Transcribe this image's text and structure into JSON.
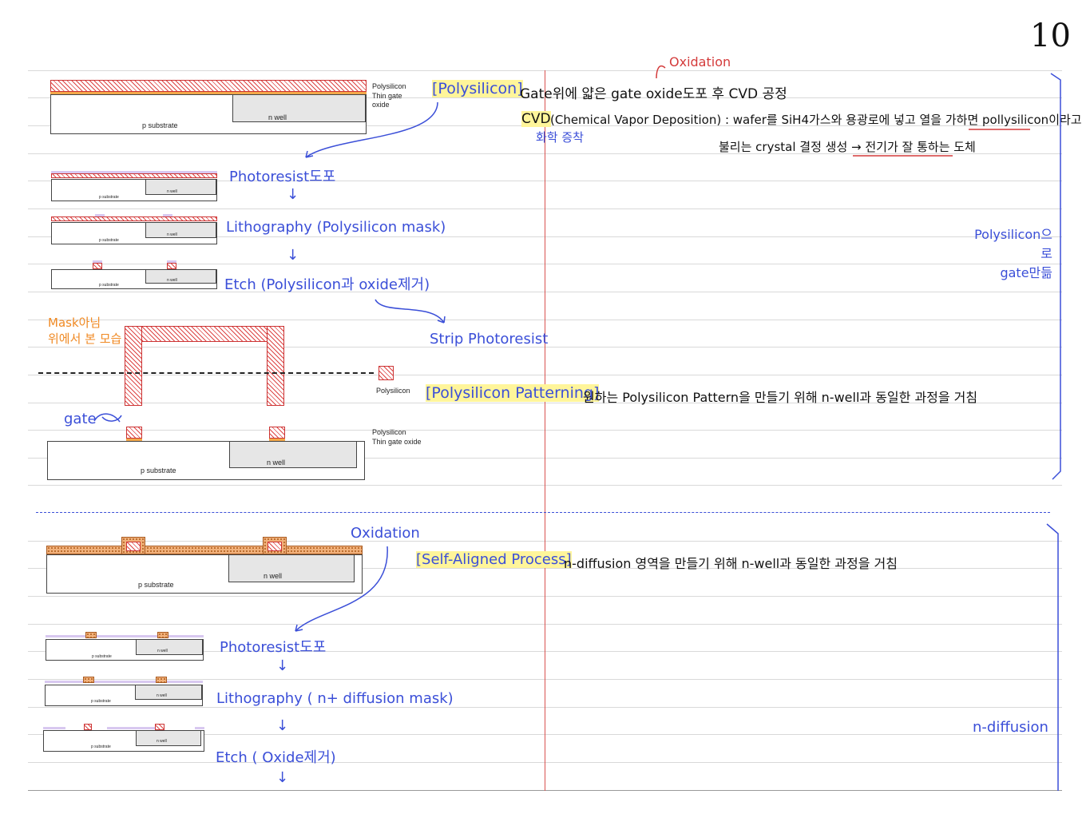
{
  "page_number": "10",
  "oxidation_note_top": "Oxidation",
  "section1": {
    "heading": "[Polysilicon]",
    "heading_desc": "Gate위에 얇은 gate oxide도포 후 CVD 공정",
    "cvd_term": "CVD",
    "cvd_desc": "(Chemical Vapor Deposition) : wafer를 SiH4가스와 용광로에 넣고 열을 가하면 pollysilicon이라고",
    "cvd_desc2": "불리는 crystal 결정 생성 → 전기가 잘 통하는 도체",
    "cvd_korean": "화학 증착",
    "step1": "Photoresist도포",
    "step2": "Lithography (Polysilicon mask)",
    "step3": "Etch (Polysilicon과 oxide제거)",
    "step4": "Strip Photoresist",
    "side_note": "Polysilicon으로\ngate만듦",
    "mask_note_1": "Mask아님",
    "mask_note_2": "위에서 본 모습",
    "patterning_heading": "[Polysilicon Patterning]",
    "patterning_desc": "원하는 Polysilicon Pattern을 만들기 위해 n-well과 동일한 과정을 거침",
    "gate_label": "gate",
    "diagram_labels": {
      "polysilicon": "Polysilicon",
      "thin_gate_oxide": "Thin gate oxide",
      "p_substrate": "p substrate",
      "n_well": "n well"
    }
  },
  "section2": {
    "oxidation": "Oxidation",
    "heading": "[Self-Aligned Process]",
    "heading_desc": "n-diffusion 영역을 만들기 위해 n-well과 동일한 과정을 거침",
    "step1": "Photoresist도포",
    "step2": "Lithography ( n+ diffusion mask)",
    "step3": "Etch ( Oxide제거)",
    "side_note": "n-diffusion"
  },
  "arrow_glyph": "↓",
  "colors": {
    "ink_blue": "#3b4fd8",
    "highlight": "#fff59a",
    "margin_red": "#d9534f",
    "note_orange": "#f08a24"
  }
}
